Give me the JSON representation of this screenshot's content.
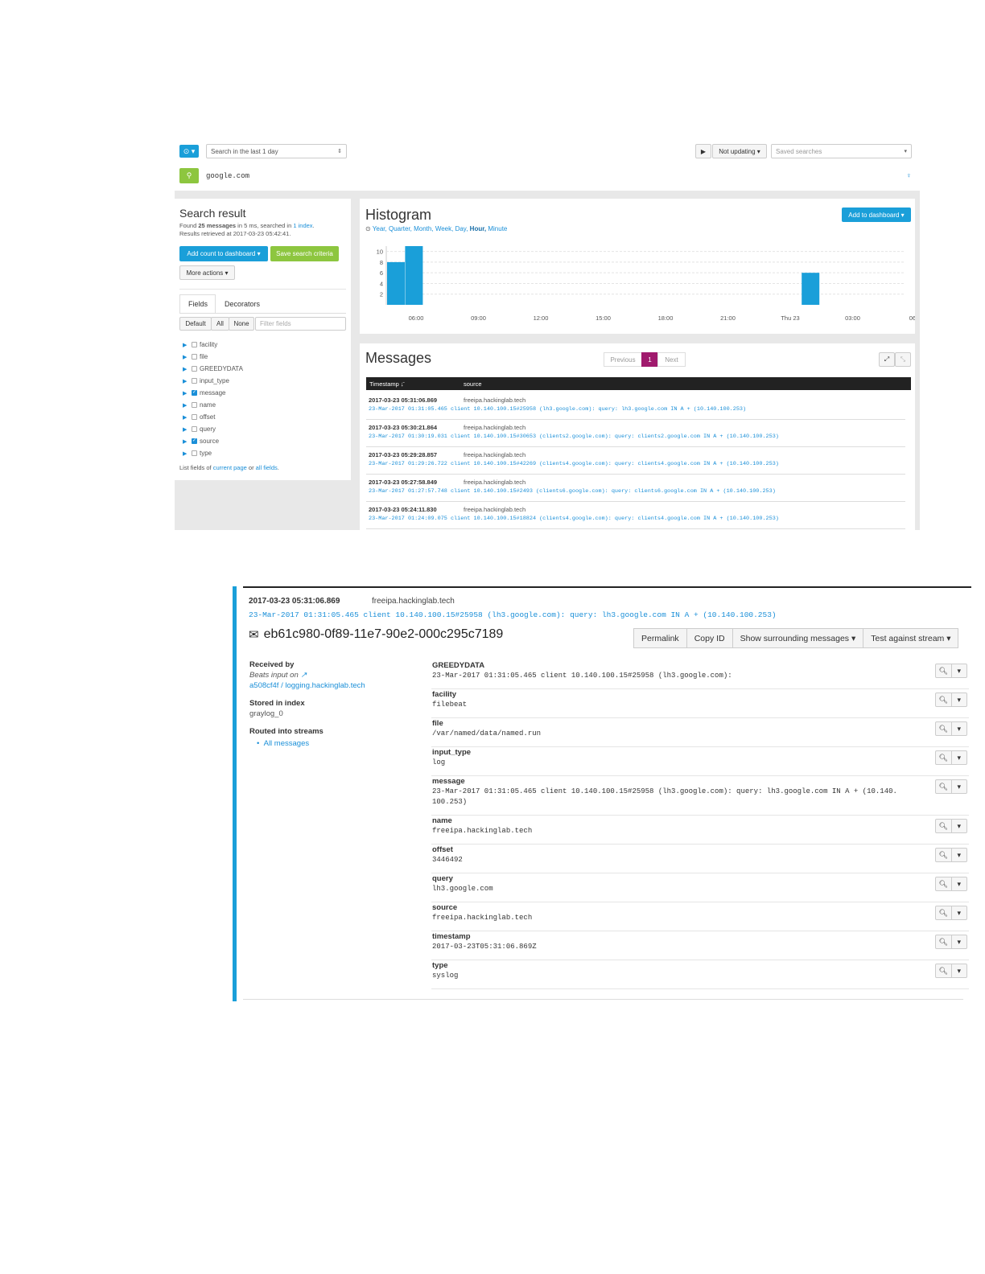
{
  "search": {
    "range_label": "Search in the last 1 day",
    "query": "google.com",
    "play_icon": "play-icon",
    "not_updating": "Not updating ▾",
    "saved_placeholder": "Saved searches"
  },
  "result": {
    "title": "Search result",
    "found_prefix": "Found ",
    "found_count": "25 messages",
    "found_mid": " in 5 ms, searched in ",
    "found_link": "1 index",
    "found_end": ".",
    "retrieved": "Results retrieved at 2017-03-23 05:42:41.",
    "add_count": "Add count to dashboard ▾",
    "save_criteria": "Save search criteria",
    "more_actions": "More actions ▾"
  },
  "tabs": {
    "fields": "Fields",
    "decorators": "Decorators"
  },
  "field_filter": {
    "default": "Default",
    "all": "All",
    "none": "None",
    "placeholder": "Filter fields"
  },
  "fields": [
    {
      "name": "facility",
      "checked": false
    },
    {
      "name": "file",
      "checked": false
    },
    {
      "name": "GREEDYDATA",
      "checked": false
    },
    {
      "name": "input_type",
      "checked": false
    },
    {
      "name": "message",
      "checked": true
    },
    {
      "name": "name",
      "checked": false
    },
    {
      "name": "offset",
      "checked": false
    },
    {
      "name": "query",
      "checked": false
    },
    {
      "name": "source",
      "checked": true
    },
    {
      "name": "type",
      "checked": false
    }
  ],
  "list_fields": {
    "prefix": "List fields of ",
    "current": "current page",
    "or": " or ",
    "all": "all fields",
    "end": "."
  },
  "histogram": {
    "title": "Histogram",
    "add_dashboard": "Add to dashboard ▾",
    "scales": [
      "Year,",
      "Quarter,",
      "Month,",
      "Week,",
      "Day,",
      "Hour,",
      "Minute"
    ],
    "active_scale": "Hour,"
  },
  "chart_data": {
    "type": "bar",
    "x_ticks": [
      "06:00",
      "09:00",
      "12:00",
      "15:00",
      "18:00",
      "21:00",
      "Thu 23",
      "03:00",
      "06:0"
    ],
    "y_ticks": [
      2,
      4,
      6,
      8,
      10
    ],
    "ylim": [
      0,
      11
    ],
    "bars": [
      {
        "position": 0.0,
        "value": 8
      },
      {
        "position": 1.0,
        "value": 11
      },
      {
        "position": 23.0,
        "value": 6
      }
    ],
    "color": "#1a9fd9",
    "grid": true
  },
  "messages": {
    "title": "Messages",
    "pager": {
      "prev": "Previous",
      "page": "1",
      "next": "Next"
    },
    "columns": {
      "timestamp": "Timestamp ↓̄",
      "source": "source"
    },
    "rows": [
      {
        "ts": "2017-03-23 05:31:06.869",
        "src": "freeipa.hackinglab.tech",
        "msg": "23-Mar-2017 01:31:05.465 client 10.140.100.15#25958 (lh3.google.com): query: lh3.google.com IN A + (10.140.100.253)"
      },
      {
        "ts": "2017-03-23 05:30:21.864",
        "src": "freeipa.hackinglab.tech",
        "msg": "23-Mar-2017 01:30:19.031 client 10.140.100.15#30653 (clients2.google.com): query: clients2.google.com IN A + (10.140.100.253)"
      },
      {
        "ts": "2017-03-23 05:29:28.857",
        "src": "freeipa.hackinglab.tech",
        "msg": "23-Mar-2017 01:29:26.722 client 10.140.100.15#42269 (clients4.google.com): query: clients4.google.com IN A + (10.140.100.253)"
      },
      {
        "ts": "2017-03-23 05:27:58.849",
        "src": "freeipa.hackinglab.tech",
        "msg": "23-Mar-2017 01:27:57.748 client 10.140.100.15#2493 (clients6.google.com): query: clients6.google.com IN A + (10.140.100.253)"
      },
      {
        "ts": "2017-03-23 05:24:11.830",
        "src": "freeipa.hackinglab.tech",
        "msg": "23-Mar-2017 01:24:09.075 client 10.140.100.15#18824 (clients4.google.com): query: clients4.google.com IN A + (10.140.100.253)"
      }
    ]
  },
  "detail": {
    "ts": "2017-03-23 05:31:06.869",
    "src": "freeipa.hackinglab.tech",
    "msg": "23-Mar-2017 01:31:05.465 client 10.140.100.15#25958 (lh3.google.com): query: lh3.google.com IN A + (10.140.100.253)",
    "id": "eb61c980-0f89-11e7-90e2-000c295c7189",
    "buttons": {
      "permalink": "Permalink",
      "copy_id": "Copy ID",
      "surrounding": "Show surrounding messages ▾",
      "test_stream": "Test against stream ▾"
    },
    "received_label": "Received by",
    "received_text": "Beats input on ",
    "received_link": " a508cf4f / logging.hackinglab.tech",
    "stored_label": "Stored in index",
    "stored_value": "graylog_0",
    "routed_label": "Routed into streams",
    "routed_stream": "All messages",
    "fields": [
      {
        "name": "GREEDYDATA",
        "value": "23-Mar-2017 01:31:05.465 client 10.140.100.15#25958 (lh3.google.com):"
      },
      {
        "name": "facility",
        "value": "filebeat"
      },
      {
        "name": "file",
        "value": "/var/named/data/named.run"
      },
      {
        "name": "input_type",
        "value": "log"
      },
      {
        "name": "message",
        "value": "23-Mar-2017 01:31:05.465 client 10.140.100.15#25958 (lh3.google.com): query: lh3.google.com IN A + (10.140.\n100.253)"
      },
      {
        "name": "name",
        "value": "freeipa.hackinglab.tech"
      },
      {
        "name": "offset",
        "value": "3446492"
      },
      {
        "name": "query",
        "value": "lh3.google.com"
      },
      {
        "name": "source",
        "value": "freeipa.hackinglab.tech"
      },
      {
        "name": "timestamp",
        "value": "2017-03-23T05:31:06.869Z"
      },
      {
        "name": "type",
        "value": "syslog"
      }
    ]
  }
}
